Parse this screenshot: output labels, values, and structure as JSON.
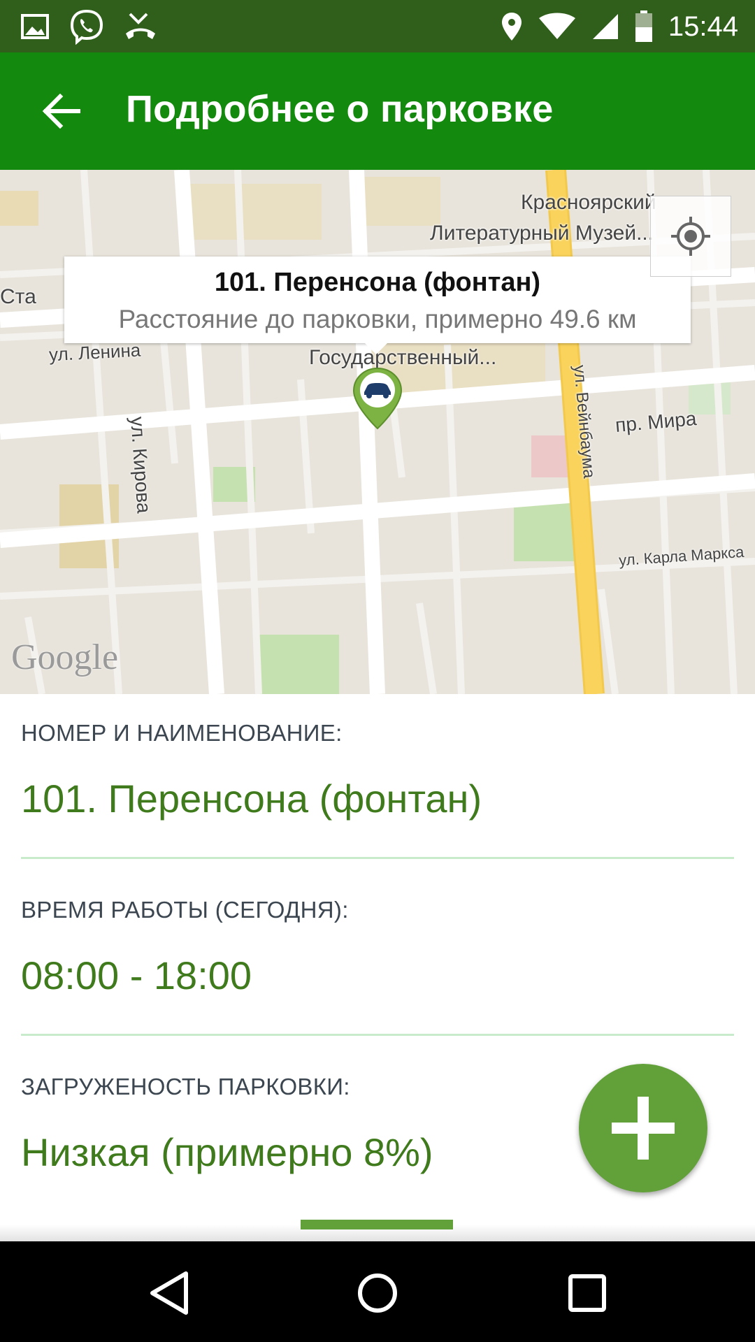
{
  "status_bar": {
    "time": "15:44",
    "left_icons": [
      "image-icon",
      "viber-icon",
      "missed-call-icon"
    ],
    "right_icons": [
      "location-icon",
      "wifi-icon",
      "signal-icon",
      "battery-icon"
    ]
  },
  "app_bar": {
    "title": "Подробнее о парковке",
    "back_icon": "arrow-back-icon"
  },
  "map": {
    "labels": {
      "museum_line1": "Красноярский",
      "museum_line2": "Литературный Музей...",
      "street_lenina": "ул. Ленина",
      "street_kirova": "ул. Кирова",
      "place_gov": "Государственный...",
      "street_veinbauma": "ул. Вейнбаума",
      "street_mira": "пр. Мира",
      "street_marksa": "ул. Карла Маркса",
      "partial_left": "Ста"
    },
    "info_window": {
      "title": "101. Перенсона (фонтан)",
      "subtitle": "Расстояние до парковки, примерно 49.6 км"
    },
    "logo": "Google",
    "colors": {
      "marker": "#7cb342",
      "highway": "#f9d35b"
    }
  },
  "details": {
    "name_label": "НОМЕР И НАИМЕНОВАНИЕ:",
    "name_value": "101. Перенсона (фонтан)",
    "hours_label": "ВРЕМЯ РАБОТЫ (СЕГОДНЯ):",
    "hours_value": "08:00 - 18:00",
    "load_label": "ЗАГРУЖЕНОСТЬ ПАРКОВКИ:",
    "load_value": "Низкая (примерно 8%)"
  },
  "fab": {
    "icon": "plus-icon"
  },
  "nav_bar": {
    "icons": [
      "back-triangle-icon",
      "home-circle-icon",
      "recents-square-icon"
    ]
  }
}
